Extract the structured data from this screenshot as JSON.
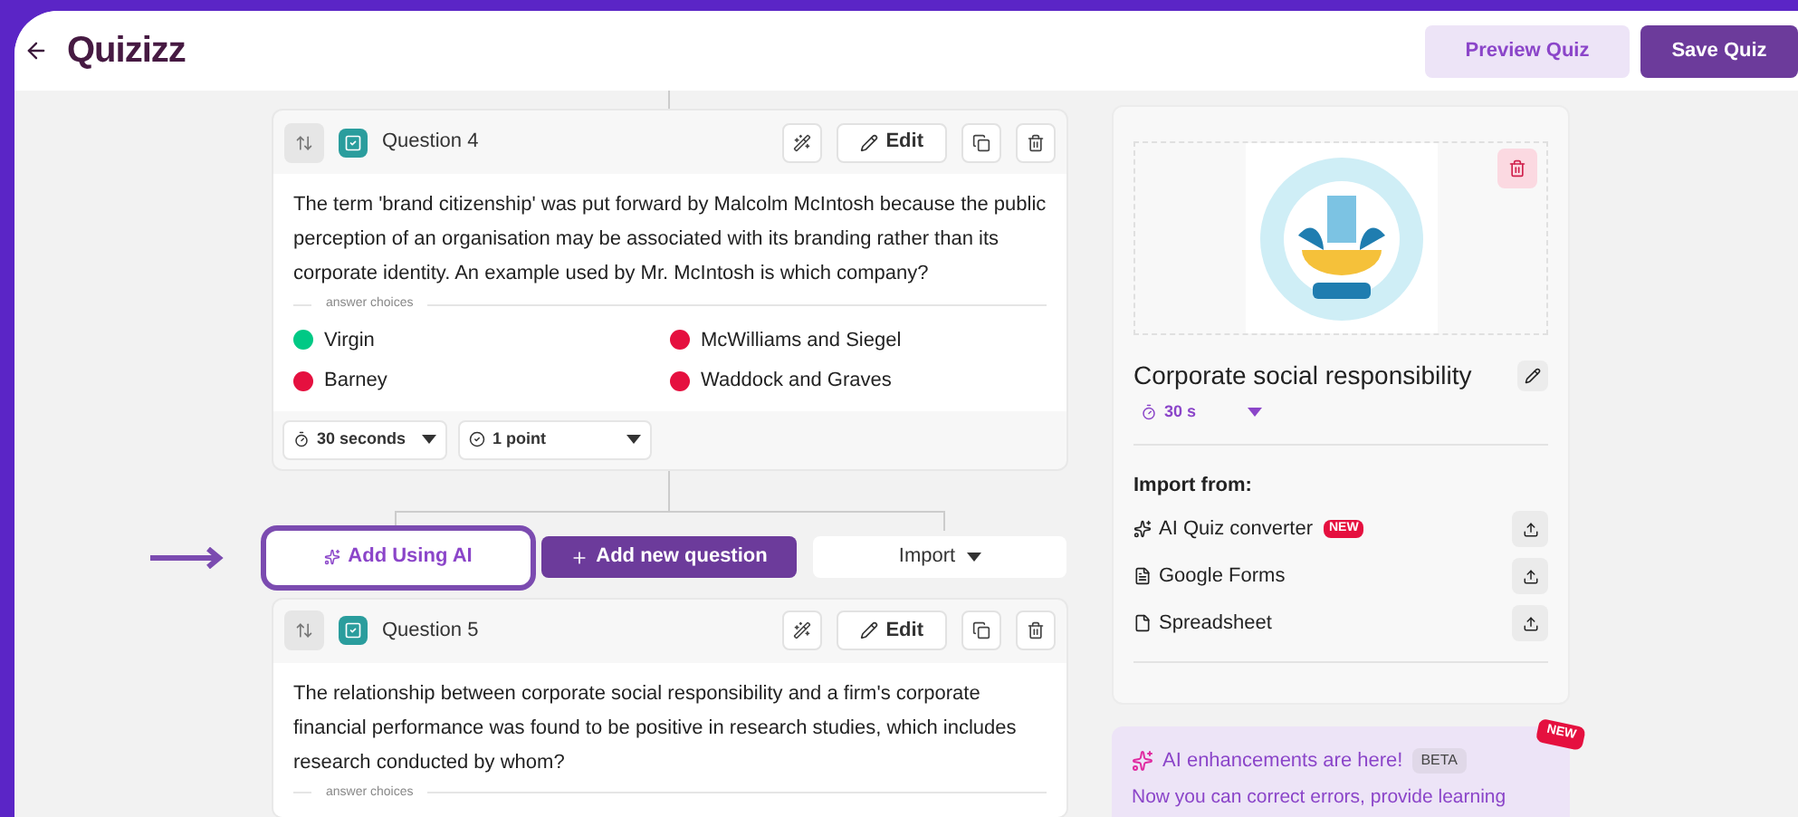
{
  "header": {
    "logo": "Quizizz",
    "buttons": [
      {
        "label": "Preview Quiz",
        "kind": "secondary"
      },
      {
        "label": "Save Quiz",
        "kind": "primary"
      }
    ]
  },
  "questions": [
    {
      "title": "Question 4",
      "edit_label": "Edit",
      "text": "The term 'brand citizenship' was put forward by Malcolm McIntosh because the public perception of an organisation may be associated with its branding rather than its corporate identity. An example used by Mr. McIntosh is which company?",
      "choices_label": "answer choices",
      "choices": [
        {
          "text": "Virgin",
          "correct": true
        },
        {
          "text": "McWilliams and Siegel",
          "correct": false
        },
        {
          "text": "Barney",
          "correct": false
        },
        {
          "text": "Waddock and Graves",
          "correct": false
        }
      ],
      "time": "30 seconds",
      "points": "1 point"
    },
    {
      "title": "Question 5",
      "edit_label": "Edit",
      "text": "The relationship between corporate social responsibility and a firm's corporate financial performance was found to be positive in research studies, which includes research conducted by whom?",
      "choices_label": "answer choices"
    }
  ],
  "add_row": {
    "ai": "Add Using AI",
    "ai_highlighted": true,
    "add": "Add new question",
    "import": "Import"
  },
  "sidebar": {
    "title": "Corporate social responsibility",
    "time": "30 s",
    "import_heading": "Import from:",
    "import_options": [
      {
        "label": "AI Quiz converter",
        "badge": "NEW",
        "kind": "ai"
      },
      {
        "label": "Google Forms",
        "kind": "form"
      },
      {
        "label": "Spreadsheet",
        "kind": "sheet"
      }
    ]
  },
  "ai_banner": {
    "title": "AI enhancements are here!",
    "badge": "BETA",
    "ribbon": "NEW",
    "text": "Now you can correct errors, provide learning"
  }
}
